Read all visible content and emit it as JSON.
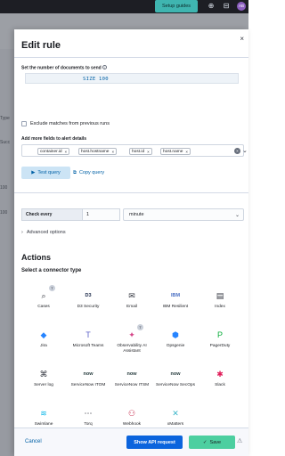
{
  "topbar": {
    "setup_label": "Setup guides",
    "avatar_initials": "AB"
  },
  "background": {
    "text1": "Type",
    "text2": "Succ",
    "text3": "100",
    "text4": "100"
  },
  "flyout": {
    "title": "Edit rule",
    "close_glyph": "×"
  },
  "query": {
    "size_label": "Set the number of documents to send",
    "size_value": "SIZE 100",
    "exclude_label": "Exclude matches from previous runs",
    "fields_label": "Add more fields to alert details",
    "fields": [
      "container.id",
      "host.hostname",
      "host.id",
      "host.name"
    ],
    "test_query_label": "Test query",
    "copy_query_label": "Copy query"
  },
  "schedule": {
    "check_every_label": "Check every",
    "interval_value": "1",
    "unit_value": "minute",
    "advanced_label": "Advanced options"
  },
  "actions": {
    "title": "Actions",
    "connector_title": "Select a connector type",
    "connectors": [
      {
        "label": "Cases",
        "icon": "cases-icon",
        "glyph": "⌕",
        "color": "#343741",
        "badge": "T"
      },
      {
        "label": "D3 Security",
        "icon": "d3-icon",
        "glyph": "D3",
        "color": "#1c2a4a"
      },
      {
        "label": "Email",
        "icon": "email-icon",
        "glyph": "✉",
        "color": "#343741"
      },
      {
        "label": "IBM Resilient",
        "icon": "ibm-icon",
        "glyph": "IBM",
        "color": "#4a70c4"
      },
      {
        "label": "Index",
        "icon": "index-icon",
        "glyph": "▤",
        "color": "#343741"
      },
      {
        "label": "Jira",
        "icon": "jira-icon",
        "glyph": "◆",
        "color": "#2684ff"
      },
      {
        "label": "Microsoft Teams",
        "icon": "teams-icon",
        "glyph": "T",
        "color": "#5b5fc7"
      },
      {
        "label": "Observability AI Assistant",
        "icon": "ai-assistant-icon",
        "glyph": "✦",
        "color": "#d6488a",
        "badge": "T"
      },
      {
        "label": "Opsgenie",
        "icon": "opsgenie-icon",
        "glyph": "⬢",
        "color": "#2684ff"
      },
      {
        "label": "PagerDuty",
        "icon": "pagerduty-icon",
        "glyph": "P",
        "color": "#06ac38"
      },
      {
        "label": "Server log",
        "icon": "server-log-icon",
        "glyph": "⌘",
        "color": "#343741"
      },
      {
        "label": "ServiceNow ITOM",
        "icon": "servicenow-icon",
        "glyph": "now",
        "color": "#293e40"
      },
      {
        "label": "ServiceNow ITSM",
        "icon": "servicenow-icon",
        "glyph": "now",
        "color": "#293e40"
      },
      {
        "label": "ServiceNow SecOps",
        "icon": "servicenow-icon",
        "glyph": "now",
        "color": "#293e40"
      },
      {
        "label": "Slack",
        "icon": "slack-icon",
        "glyph": "✱",
        "color": "#e01e5a"
      },
      {
        "label": "Swimlane",
        "icon": "swimlane-icon",
        "glyph": "≋",
        "color": "#0fb7e8"
      },
      {
        "label": "Torq",
        "icon": "torq-icon",
        "glyph": "⋯",
        "color": "#343741"
      },
      {
        "label": "Webhook",
        "icon": "webhook-icon",
        "glyph": "⚇",
        "color": "#c93655"
      },
      {
        "label": "xMatters",
        "icon": "xmatters-icon",
        "glyph": "✕",
        "color": "#3db5c9"
      }
    ]
  },
  "footer": {
    "cancel_label": "Cancel",
    "api_label": "Show API request",
    "save_label": "Save"
  }
}
